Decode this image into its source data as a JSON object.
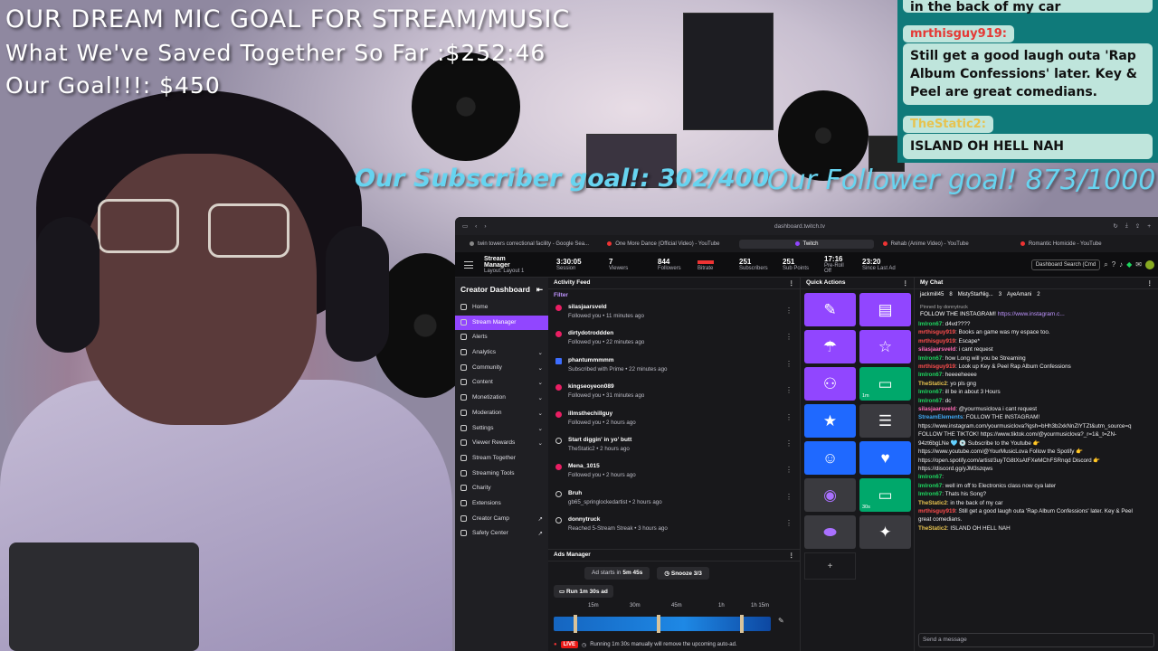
{
  "overlay": {
    "line1": "OUR DREAM MIC GOAL FOR STREAM/MUSIC",
    "line2": "What We've Saved Together So Far :$252:46",
    "line3": "Our Goal!!!: $450",
    "subscriber_goal": "Our Subscriber goal!: 302/400",
    "follower_goal": "Our Follower goal! 873/1000"
  },
  "overlay_chat": {
    "top_msg": "in the back of my car",
    "user1": "mrthisguy919:",
    "msg1": "Still get a good laugh outa 'Rap Album Confessions' later. Key & Peel are great comedians.",
    "user2": "TheStatic2:",
    "msg2": "ISLAND OH HELL NAH"
  },
  "browser": {
    "url": "dashboard.twitch.tv",
    "tabs": [
      {
        "label": "twin towers correctional facility - Google Sea..."
      },
      {
        "label": "One More Dance (Official Video) - YouTube"
      },
      {
        "label": "Twitch"
      },
      {
        "label": "Rehab (Anime Video) - YouTube"
      },
      {
        "label": "Romantic Homicide - YouTube"
      }
    ]
  },
  "statbar": {
    "title": "Stream Manager",
    "layout": "Layout: Layout 1",
    "stats": [
      {
        "value": "3:30:05",
        "label": "Session"
      },
      {
        "value": "7",
        "label": "Viewers"
      },
      {
        "value": "844",
        "label": "Followers"
      },
      {
        "value": "",
        "label": "Bitrate"
      },
      {
        "value": "251",
        "label": "Subscribers"
      },
      {
        "value": "251",
        "label": "Sub Points"
      },
      {
        "value": "17:16",
        "label": "Pre-Roll Off"
      },
      {
        "value": "23:20",
        "label": "Since Last Ad"
      }
    ],
    "search_placeholder": "Dashboard Search (Cmd"
  },
  "sidebar": {
    "title": "Creator Dashboard",
    "items": [
      {
        "label": "Home",
        "arrow": ""
      },
      {
        "label": "Stream Manager",
        "arrow": ""
      },
      {
        "label": "Alerts",
        "arrow": ""
      },
      {
        "label": "Analytics",
        "arrow": "⌄"
      },
      {
        "label": "Community",
        "arrow": "⌄"
      },
      {
        "label": "Content",
        "arrow": "⌄"
      },
      {
        "label": "Monetization",
        "arrow": "⌄"
      },
      {
        "label": "Moderation",
        "arrow": "⌄"
      },
      {
        "label": "Settings",
        "arrow": "⌄"
      },
      {
        "label": "Viewer Rewards",
        "arrow": "⌄"
      },
      {
        "label": "Stream Together",
        "arrow": ""
      },
      {
        "label": "Streaming Tools",
        "arrow": ""
      },
      {
        "label": "Charity",
        "arrow": ""
      },
      {
        "label": "Extensions",
        "arrow": ""
      },
      {
        "label": "Creator Camp",
        "arrow": "↗"
      },
      {
        "label": "Safety Center",
        "arrow": "↗"
      }
    ]
  },
  "activity": {
    "title": "Activity Feed",
    "filter": "Filter",
    "items": [
      {
        "name": "silasjaarsveld",
        "desc": "Followed you • 11 minutes ago",
        "kind": "follow"
      },
      {
        "name": "dirtydotroddden",
        "desc": "Followed you • 22 minutes ago",
        "kind": "follow"
      },
      {
        "name": "phantummmmm",
        "desc": "Subscribed with Prime • 22 minutes ago",
        "kind": "sub"
      },
      {
        "name": "kingseoyeon089",
        "desc": "Followed you • 31 minutes ago",
        "kind": "follow"
      },
      {
        "name": "illmsthechillguy",
        "desc": "Followed you • 2 hours ago",
        "kind": "follow"
      },
      {
        "name": "Start diggin' in yo' butt",
        "desc": "TheStatic2 • 2 hours ago",
        "kind": "ring"
      },
      {
        "name": "Mena_1015",
        "desc": "Followed you • 2 hours ago",
        "kind": "follow"
      },
      {
        "name": "Bruh",
        "desc": "gb65_springlockedartist • 2 hours ago",
        "kind": "ring"
      },
      {
        "name": "donnytruck",
        "desc": "Reached 5-Stream Streak • 3 hours ago",
        "kind": "ring"
      }
    ]
  },
  "ads": {
    "title": "Ads Manager",
    "starts_label": "Ad starts in",
    "starts_value": "5m 45s",
    "snooze": "Snooze 3/3",
    "run": "Run 1m 30s ad",
    "ticks": [
      "15m",
      "30m",
      "45m",
      "1h",
      "1h 15m"
    ],
    "live": "LIVE",
    "note": "Running 1m 30s manually will remove the upcoming auto-ad."
  },
  "quick": {
    "title": "Quick Actions",
    "buttons": [
      {
        "icon": "pencil-icon",
        "glyph": "✎",
        "color": "purple",
        "sub": ""
      },
      {
        "icon": "clapper-icon",
        "glyph": "🎬",
        "color": "purple",
        "sub": ""
      },
      {
        "icon": "parachute-icon",
        "glyph": "☂",
        "color": "purple",
        "sub": ""
      },
      {
        "icon": "star-outline-icon",
        "glyph": "☆",
        "color": "purple",
        "sub": ""
      },
      {
        "icon": "add-user-icon",
        "glyph": "👤+",
        "color": "purple",
        "sub": ""
      },
      {
        "icon": "ad-icon",
        "glyph": "▭",
        "color": "green",
        "sub": "1m"
      },
      {
        "icon": "star-icon",
        "glyph": "★",
        "color": "blue",
        "sub": ""
      },
      {
        "icon": "list-icon",
        "glyph": "☰",
        "color": "grey",
        "sub": ""
      },
      {
        "icon": "smiley-icon",
        "glyph": "☺",
        "color": "blue",
        "sub": ""
      },
      {
        "icon": "heart-icon",
        "glyph": "♥",
        "color": "blue",
        "sub": ""
      },
      {
        "icon": "podcast-icon",
        "glyph": "◉",
        "color": "grey",
        "sub": ""
      },
      {
        "icon": "ad-30s-icon",
        "glyph": "▭",
        "color": "green",
        "sub": "30s"
      },
      {
        "icon": "shape-icon",
        "glyph": "⬬",
        "color": "grey",
        "sub": ""
      },
      {
        "icon": "logo-icon",
        "glyph": "✦",
        "color": "grey",
        "sub": ""
      }
    ],
    "add": "+"
  },
  "chat": {
    "title": "My Chat",
    "users": [
      "jackmill45",
      "8",
      "MistyStarNig...",
      "3",
      "AyeAmani",
      "2"
    ],
    "pinned_by": "Pinned by donnytruck",
    "pinned_text": "FOLLOW THE INSTAGRAM!",
    "pinned_link": "https://www.instagram.c...",
    "messages": [
      {
        "user": "lmlron67",
        "color": "green",
        "text": ": d4vd????"
      },
      {
        "user": "mrthisguy919",
        "color": "red",
        "text": ": Books an game was my espace too."
      },
      {
        "user": "mrthisguy919",
        "color": "red",
        "text": ": Escape*"
      },
      {
        "user": "silasjaarsveld",
        "color": "pink",
        "text": ": i cant request"
      },
      {
        "user": "lmlron67",
        "color": "green",
        "text": ": how Long will you be Streaming"
      },
      {
        "user": "mrthisguy919",
        "color": "red",
        "text": ": Look up Key & Peel Rap Album Confessions"
      },
      {
        "user": "lmlron67",
        "color": "green",
        "text": ": heeeeheeee"
      },
      {
        "user": "TheStatic2",
        "color": "yellow",
        "text": ": yo pls gng"
      },
      {
        "user": "lmlron67",
        "color": "green",
        "text": ": ill be in about 3 Hours"
      },
      {
        "user": "lmlron67",
        "color": "green",
        "text": ": dc"
      },
      {
        "user": "silasjaarsveld",
        "color": "pink",
        "text": ": @yourmusiclova i cant request"
      },
      {
        "user": "StreamElements",
        "color": "blue",
        "text": ": FOLLOW THE INSTAGRAM!"
      },
      {
        "user": "",
        "color": "blue",
        "text": "https://www.instagram.com/yourmusiclova?igsh=bHh3b2xkNnZlYTZt&utm_source=q"
      },
      {
        "user": "",
        "color": "blue",
        "text": "FOLLOW THE TIKTOK! https://www.tiktok.com/@yourmusiclova?_r=1&_t=ZN-"
      },
      {
        "user": "",
        "color": "blue",
        "text": "94zt6bgLNe 🩵 💿 Subscribe to the Youtube 👉"
      },
      {
        "user": "",
        "color": "blue",
        "text": "https://www.youtube.com/@YourMusicLova Follow the Spotify 👉"
      },
      {
        "user": "",
        "color": "blue",
        "text": "https://open.spotify.com/artist/3uyTG8tXsAtFXeMChFSRnqd Discord 👉"
      },
      {
        "user": "",
        "color": "blue",
        "text": "https://discord.gg/yJM3szqws"
      },
      {
        "user": "lmlron67",
        "color": "green",
        "text": ":"
      },
      {
        "user": "lmlron67",
        "color": "green",
        "text": ": well im off to Electronics class now cya later"
      },
      {
        "user": "lmlron67",
        "color": "green",
        "text": ": Thats his Song?"
      },
      {
        "user": "TheStatic2",
        "color": "yellow",
        "text": ": in the back of my car"
      },
      {
        "user": "mrthisguy919",
        "color": "red",
        "text": ": Still get a good laugh outa 'Rap Album Confessions' later. Key & Peel"
      },
      {
        "user": "",
        "color": "red",
        "text": "great comedians."
      },
      {
        "user": "TheStatic2",
        "color": "yellow",
        "text": ": ISLAND OH HELL NAH"
      }
    ],
    "input_placeholder": "Send a message"
  }
}
